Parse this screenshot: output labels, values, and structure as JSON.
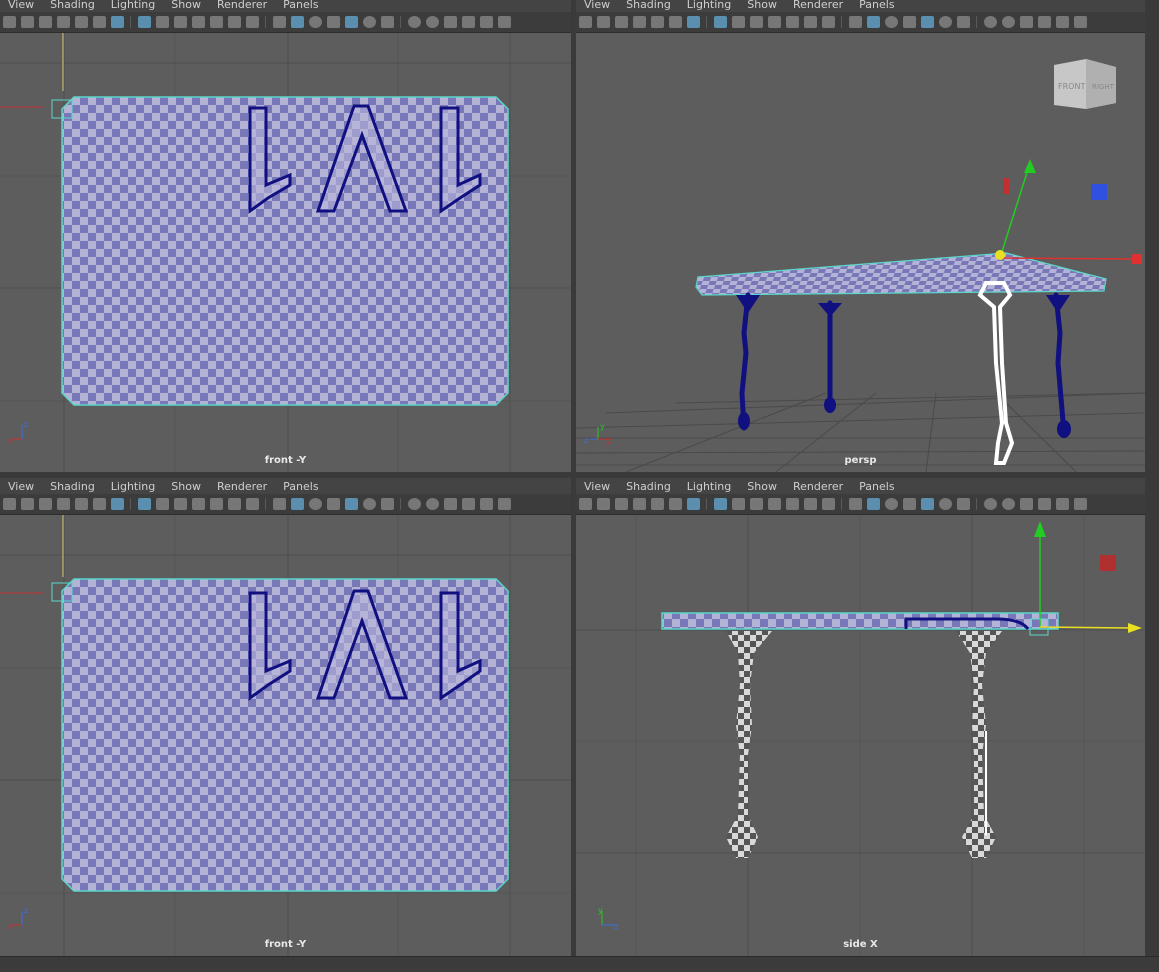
{
  "menu": [
    "View",
    "Shading",
    "Lighting",
    "Show",
    "Renderer",
    "Panels"
  ],
  "viewports": {
    "top_left": {
      "label": "front -Y"
    },
    "top_right": {
      "label": "persp",
      "viewcube_front": "FRONT",
      "viewcube_right": "RIGHT"
    },
    "bottom_left": {
      "label": "front -Y"
    },
    "bottom_right": {
      "label": "side X"
    }
  },
  "axis_labels": {
    "x": "x",
    "y": "y",
    "z": "z"
  },
  "colors": {
    "panel_bg": "#5d5d5d",
    "grid": "#4e4e4e",
    "checker_a": "#7877b8",
    "checker_b": "#b4b3d6",
    "outline": "#5ad8c9",
    "curve": "#101080",
    "manip_y": "#22cc22",
    "manip_x": "#e03030",
    "manip_z": "#3050e0",
    "manip_yellow": "#e8e020"
  }
}
